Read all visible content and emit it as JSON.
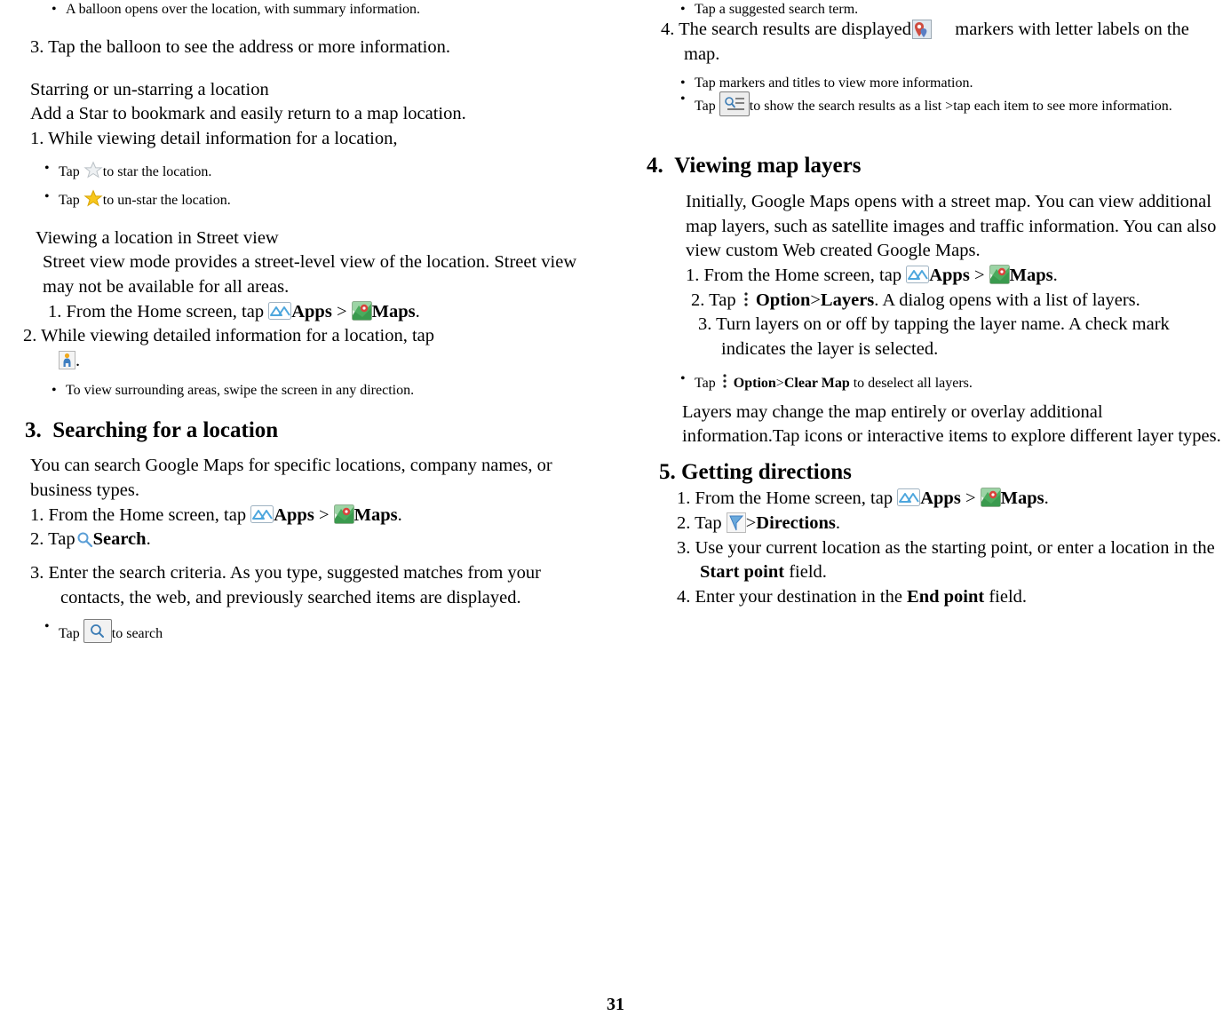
{
  "page": {
    "number": "31"
  },
  "left_column": {
    "b1": "A balloon opens over the location, with summary information.",
    "s3": "3. Tap the balloon to see the address or more information.",
    "h_star": "Starring or un-starring a location",
    "star_desc": "Add a Star to bookmark and easily return to a map location.",
    "star_1": "1. While viewing detail information for a location,",
    "star_b1_pre": "Tap",
    "star_b1_post": "to star the location.",
    "star_b2_pre": "Tap",
    "star_b2_post": "to un-star the location.",
    "h_street": "Viewing a location in Street view",
    "street_desc": "Street view mode provides a street-level view of the location. Street view may not be available for all areas.",
    "street_1_pre": "1. From the Home screen, tap",
    "street_1_apps": "Apps",
    "street_1_gt": ">",
    "street_1_maps": "Maps",
    "street_1_end": ".",
    "street_2": "2. While viewing detailed information for a location, tap",
    "street_2_end": ".",
    "street_b1": "To view surrounding areas, swipe the screen in any direction.",
    "sect3_num": "3.",
    "sect3_title": "Searching for a location",
    "search_desc": "You can search Google Maps for specific locations, company names, or business types.",
    "search_1_pre": "1. From the Home screen, tap",
    "search_1_apps": "Apps",
    "search_1_gt": ">",
    "search_1_maps": "Maps",
    "search_1_end": ".",
    "search_2_pre": "2. Tap",
    "search_2_bold": "Search",
    "search_2_end": ".",
    "search_3": "3. Enter the search criteria. As you type, suggested matches from your contacts, the web, and previously searched items are displayed.",
    "search_b1_pre": "Tap",
    "search_b1_post": "to search"
  },
  "right_column": {
    "b1": "Tap a suggested search term.",
    "s4_pre": "4. The search results are displayed as",
    "s4_post": "markers with letter labels on the map.",
    "b2": "Tap markers and titles to view more information.",
    "b3_pre": "Tap",
    "b3_post": "to show the search results as a list >tap each item to see more information.",
    "sect4_num": "4.",
    "sect4_title": "Viewing map layers",
    "layers_desc": "Initially, Google Maps opens with a street map. You can view additional map layers, such as satellite images and traffic information. You can also view custom Web created Google Maps.",
    "layers_1_pre": "1. From the Home screen, tap",
    "layers_1_apps": "Apps",
    "layers_1_gt": ">",
    "layers_1_maps": "Maps",
    "layers_1_end": ".",
    "layers_2_pre": "2. Tap",
    "layers_2_option": "Option",
    "layers_2_gt": ">",
    "layers_2_layers": "Layers",
    "layers_2_post": ". A dialog opens with a list of layers.",
    "layers_3": "3. Turn layers on or off by tapping the layer name. A check mark indicates the layer is selected.",
    "layers_b1_pre": "Tap",
    "layers_b1_option": "Option",
    "layers_b1_gt": ">",
    "layers_b1_clear": "Clear Map",
    "layers_b1_post": "to deselect all layers.",
    "layers_tail": "Layers may change the map entirely or overlay additional information.Tap icons or interactive items to explore different layer types.",
    "sect5_title": "5. Getting directions",
    "dir_1_pre": "1. From the Home screen, tap",
    "dir_1_apps": "Apps",
    "dir_1_gt": ">",
    "dir_1_maps": "Maps",
    "dir_1_end": ".",
    "dir_2_pre": "2. Tap",
    "dir_2_gt": ">",
    "dir_2_bold": "Directions",
    "dir_2_end": ".",
    "dir_3_pre": "3. Use your current location as the starting point, or enter a location in the",
    "dir_3_bold": "Start point",
    "dir_3_post": "field.",
    "dir_4_pre": "4. Enter your destination in the",
    "dir_4_bold": "End point",
    "dir_4_post": "field."
  },
  "icons": {
    "apps": "apps-grid-icon",
    "maps": "google-maps-icon",
    "star_gray": "star-outline-icon",
    "star_yellow": "star-filled-icon",
    "pegman": "street-view-pegman-icon",
    "search": "search-magnifier-icon",
    "search_box": "search-button-icon",
    "list_box": "list-view-icon",
    "marker": "map-marker-icon",
    "option": "more-options-vertical-dots-icon",
    "directions": "directions-arrow-icon"
  },
  "colors": {
    "apps_blue": "#4da6dd",
    "maps_green": "#3a9a4e",
    "maps_red": "#d9433c",
    "star_yellow": "#f2c200",
    "star_gray": "#cfd3d6",
    "directions_blue": "#5a9ed6"
  }
}
